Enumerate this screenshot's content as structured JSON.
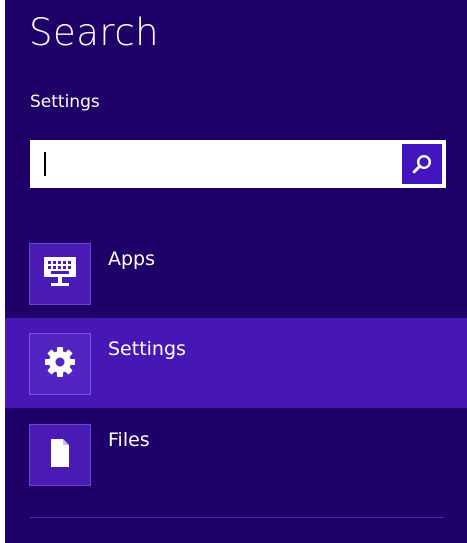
{
  "search_pane": {
    "title": "Search",
    "scope_label": "Settings",
    "search_field": {
      "value": "",
      "placeholder": ""
    },
    "search_button_icon": "search-icon"
  },
  "results": [
    {
      "label": "Apps",
      "icon": "keyboard-icon",
      "selected": false
    },
    {
      "label": "Settings",
      "icon": "gear-icon",
      "selected": true
    },
    {
      "label": "Files",
      "icon": "document-icon",
      "selected": false
    }
  ],
  "colors": {
    "background": "#1f0068",
    "selected_row": "#4617b4",
    "icon_tile": "#4b1bb6",
    "search_button": "#4214bd",
    "text": "#ffffff"
  }
}
